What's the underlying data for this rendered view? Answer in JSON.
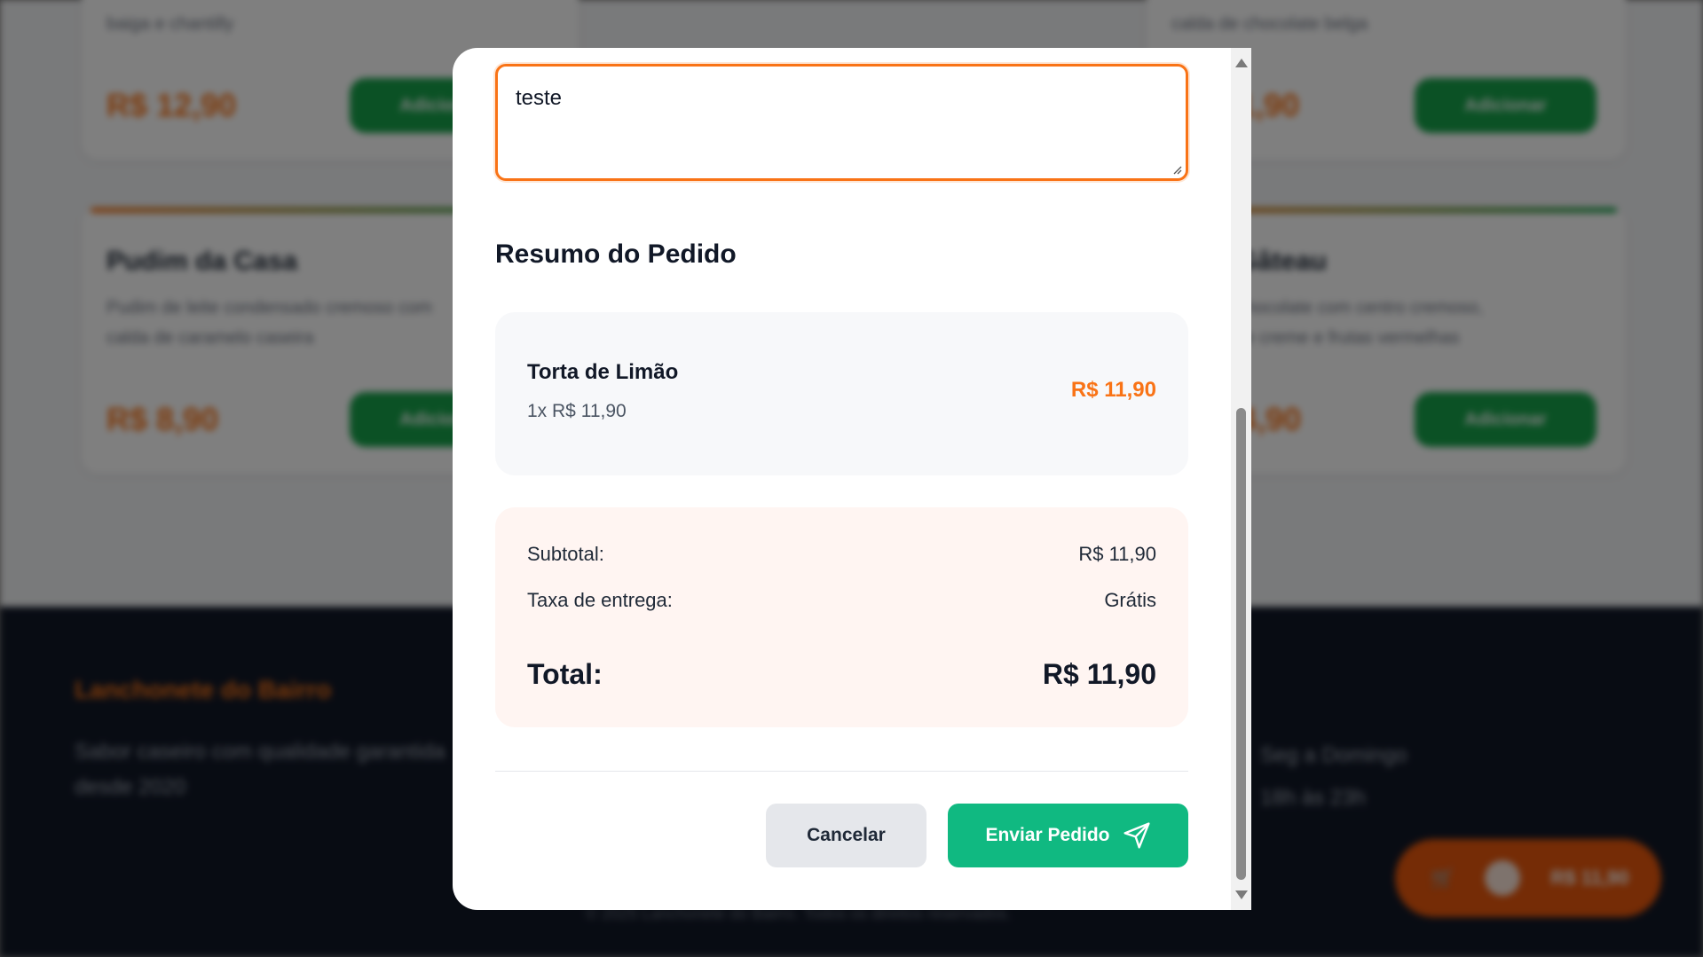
{
  "background": {
    "cards": [
      {
        "title": "",
        "desc": "baiga e chantilly",
        "price": "R$ 12,90",
        "button": "Adicionar"
      },
      {
        "title": "",
        "desc": "calda de chocolate belga",
        "price": "R$ 11,90",
        "button": "Adicionar"
      },
      {
        "title": "Pudim da Casa",
        "desc": "Pudim de leite condensado cremoso com calda de caramelo caseira",
        "price": "R$ 8,90",
        "button": "Adicionar"
      },
      {
        "title": "Petit Gâteau",
        "desc": "Bolo de chocolate com centro cremoso, sorvete de creme e frutas vermelhas",
        "price": "R$ 14,90",
        "button": "Adicionar"
      }
    ],
    "footer": {
      "brand": "Lanchonete do Bairro",
      "tagline": "Sabor caseiro com qualidade garantida desde 2020",
      "hours": [
        "Seg a Domingo",
        "18h às 23h"
      ],
      "copyright": "© 2025 Lanchonete do Bairro. Todos os direitos reservados."
    },
    "cart": {
      "total": "R$ 11,90"
    }
  },
  "modal": {
    "notes_value": "teste",
    "summary_title": "Resumo do Pedido",
    "items": [
      {
        "name": "Torta de Limão",
        "qty_line": "1x R$ 11,90",
        "price": "R$ 11,90"
      }
    ],
    "totals": {
      "subtotal_label": "Subtotal:",
      "subtotal_value": "R$ 11,90",
      "delivery_label": "Taxa de entrega:",
      "delivery_value": "Grátis",
      "total_label": "Total:",
      "total_value": "R$ 11,90"
    },
    "buttons": {
      "cancel": "Cancelar",
      "send": "Enviar Pedido"
    }
  },
  "colors": {
    "accent_orange": "#f97316",
    "send_green": "#10b981",
    "totals_bg": "#fff5f2"
  },
  "icons": {
    "send": "paper-plane-icon",
    "scroll_up": "scroll-up-arrow-icon",
    "scroll_down": "scroll-down-arrow-icon"
  }
}
